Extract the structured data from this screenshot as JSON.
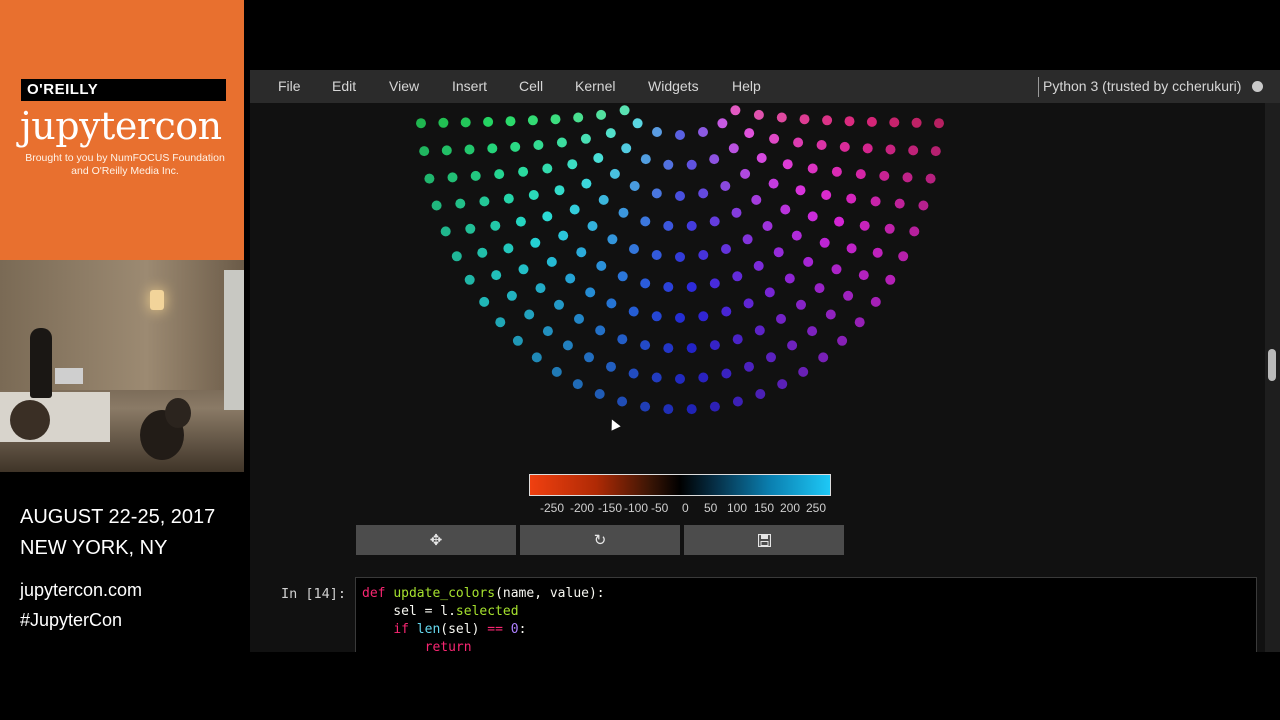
{
  "conference": {
    "publisher": "O'REILLY",
    "logo": "jupytercon",
    "sponsor_line": "Brought to you by NumFOCUS Foundation and O'Reilly Media Inc.",
    "date": "AUGUST 22-25, 2017",
    "location": "NEW YORK, NY",
    "website": "jupytercon.com",
    "hashtag": "#JupyterCon"
  },
  "menubar": {
    "items": [
      "File",
      "Edit",
      "View",
      "Insert",
      "Cell",
      "Kernel",
      "Widgets",
      "Help"
    ],
    "kernel_status": "Python 3 (trusted by ccherukuri)"
  },
  "colorbar": {
    "ticks": [
      "-250",
      "-200",
      "-150",
      "-100",
      "-50",
      "0",
      "50",
      "100",
      "150",
      "200",
      "250"
    ],
    "colors": [
      "#f04010",
      "#000000",
      "#1ec8f6"
    ]
  },
  "toolbar": {
    "buttons": [
      "move-icon",
      "refresh-icon",
      "save-icon"
    ]
  },
  "code_cell": {
    "prompt": "In [14]:",
    "lines": [
      "def update_colors(name, value):",
      "    sel = l.selected",
      "    if len(sel) == 0:",
      "        return"
    ]
  },
  "colors": {
    "menubar_bg": "#2b2b2b",
    "brand_orange": "#e8702f",
    "notebook_bg": "#111111"
  }
}
